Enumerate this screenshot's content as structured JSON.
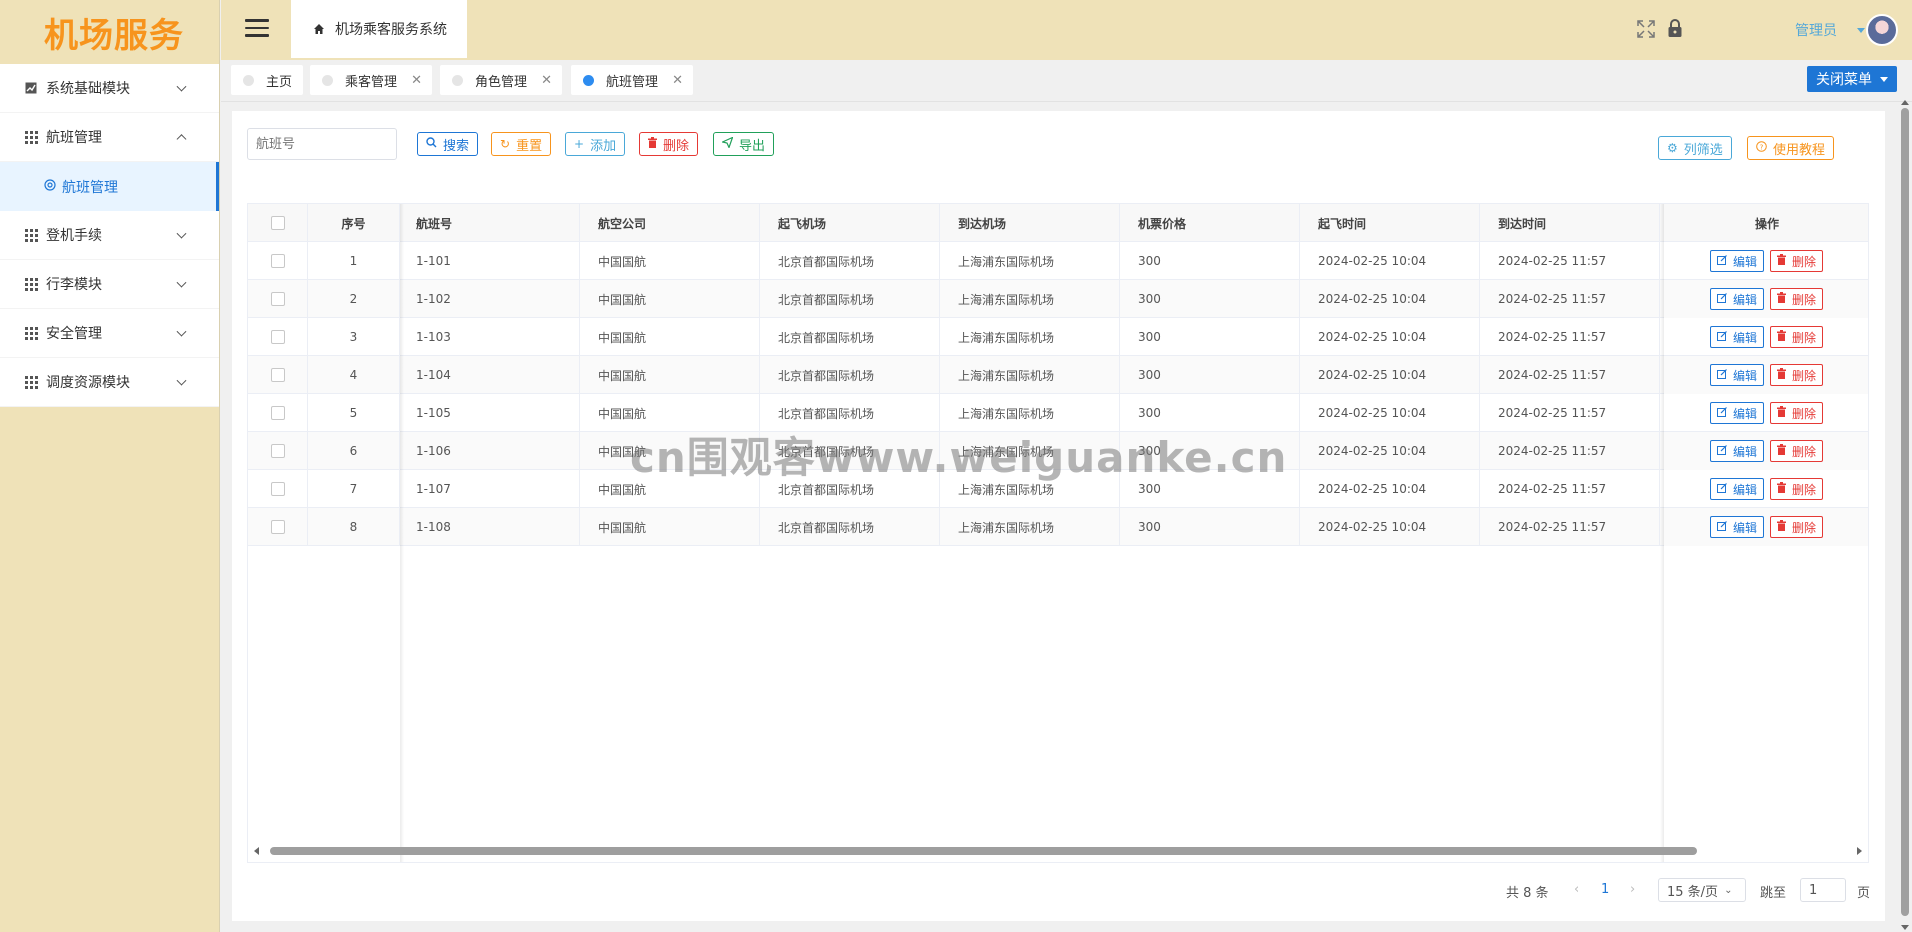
{
  "logo": "机场服务",
  "sidebar": {
    "items": [
      {
        "label": "系统基础模块",
        "icon": "chart-icon",
        "expanded": false
      },
      {
        "label": "航班管理",
        "icon": "grid-icon",
        "expanded": true
      },
      {
        "label": "登机手续",
        "icon": "grid-icon",
        "expanded": false
      },
      {
        "label": "行李模块",
        "icon": "grid-icon",
        "expanded": false
      },
      {
        "label": "安全管理",
        "icon": "grid-icon",
        "expanded": false
      },
      {
        "label": "调度资源模块",
        "icon": "grid-icon",
        "expanded": false
      }
    ],
    "sub_active": "航班管理"
  },
  "header": {
    "breadcrumb": "机场乘客服务系统",
    "user": "管理员"
  },
  "tabs": [
    {
      "label": "主页",
      "active": false,
      "closable": false
    },
    {
      "label": "乘客管理",
      "active": false,
      "closable": true
    },
    {
      "label": "角色管理",
      "active": false,
      "closable": true
    },
    {
      "label": "航班管理",
      "active": true,
      "closable": true
    }
  ],
  "close_menu": "关闭菜单",
  "toolbar": {
    "search_placeholder": "航班号",
    "search": "搜索",
    "reset": "重置",
    "add": "添加",
    "delete": "删除",
    "export": "导出",
    "column_filter": "列筛选",
    "tutorial": "使用教程"
  },
  "table": {
    "headers": [
      "序号",
      "航班号",
      "航空公司",
      "起飞机场",
      "到达机场",
      "机票价格",
      "起飞时间",
      "到达时间",
      "操作"
    ],
    "edit_label": "编辑",
    "delete_label": "删除",
    "rows": [
      {
        "no": "1",
        "flight": "1-101",
        "airline": "中国国航",
        "from": "北京首都国际机场",
        "to": "上海浦东国际机场",
        "price": "300",
        "dep": "2024-02-25 10:04",
        "arr": "2024-02-25 11:57"
      },
      {
        "no": "2",
        "flight": "1-102",
        "airline": "中国国航",
        "from": "北京首都国际机场",
        "to": "上海浦东国际机场",
        "price": "300",
        "dep": "2024-02-25 10:04",
        "arr": "2024-02-25 11:57"
      },
      {
        "no": "3",
        "flight": "1-103",
        "airline": "中国国航",
        "from": "北京首都国际机场",
        "to": "上海浦东国际机场",
        "price": "300",
        "dep": "2024-02-25 10:04",
        "arr": "2024-02-25 11:57"
      },
      {
        "no": "4",
        "flight": "1-104",
        "airline": "中国国航",
        "from": "北京首都国际机场",
        "to": "上海浦东国际机场",
        "price": "300",
        "dep": "2024-02-25 10:04",
        "arr": "2024-02-25 11:57"
      },
      {
        "no": "5",
        "flight": "1-105",
        "airline": "中国国航",
        "from": "北京首都国际机场",
        "to": "上海浦东国际机场",
        "price": "300",
        "dep": "2024-02-25 10:04",
        "arr": "2024-02-25 11:57"
      },
      {
        "no": "6",
        "flight": "1-106",
        "airline": "中国国航",
        "from": "北京首都国际机场",
        "to": "上海浦东国际机场",
        "price": "300",
        "dep": "2024-02-25 10:04",
        "arr": "2024-02-25 11:57"
      },
      {
        "no": "7",
        "flight": "1-107",
        "airline": "中国国航",
        "from": "北京首都国际机场",
        "to": "上海浦东国际机场",
        "price": "300",
        "dep": "2024-02-25 10:04",
        "arr": "2024-02-25 11:57"
      },
      {
        "no": "8",
        "flight": "1-108",
        "airline": "中国国航",
        "from": "北京首都国际机场",
        "to": "上海浦东国际机场",
        "price": "300",
        "dep": "2024-02-25 10:04",
        "arr": "2024-02-25 11:57"
      }
    ]
  },
  "pagination": {
    "total": "共 8 条",
    "current": "1",
    "page_size": "15 条/页",
    "goto_label": "跳至",
    "goto_value": "1",
    "page_unit": "页"
  },
  "watermark": "cn围观客www.weiguanke.cn",
  "colors": {
    "primary": "#1e76d5",
    "orange": "#f7941d",
    "danger": "#e53935",
    "success": "#21a05a",
    "sidebar_bg": "#efe2b8"
  }
}
